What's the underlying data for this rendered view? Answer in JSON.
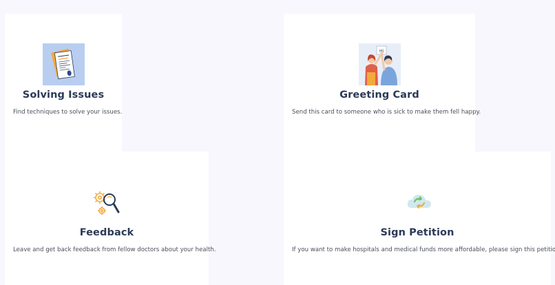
{
  "cards": [
    {
      "title": "Solving Issues",
      "description": "Find techniques to solve your issues.",
      "icon": "document-icon"
    },
    {
      "title": "Greeting Card",
      "description": "Send this card to someone who is sick to make them fell happy.",
      "icon": "greeting-people-icon"
    },
    {
      "title": "Feedback",
      "description": "Leave and get back feedback from fellow doctors about your health.",
      "icon": "gears-magnifier-icon"
    },
    {
      "title": "Sign Petition",
      "description": "If you want to make hospitals and medical funds more affordable, please sign this petition.",
      "icon": "cloud-sync-icon"
    }
  ],
  "colors": {
    "page_background": "#f7f7fd",
    "card_background": "#ffffff",
    "title_color": "#2b3a55",
    "text_color": "#4a4f5c"
  }
}
